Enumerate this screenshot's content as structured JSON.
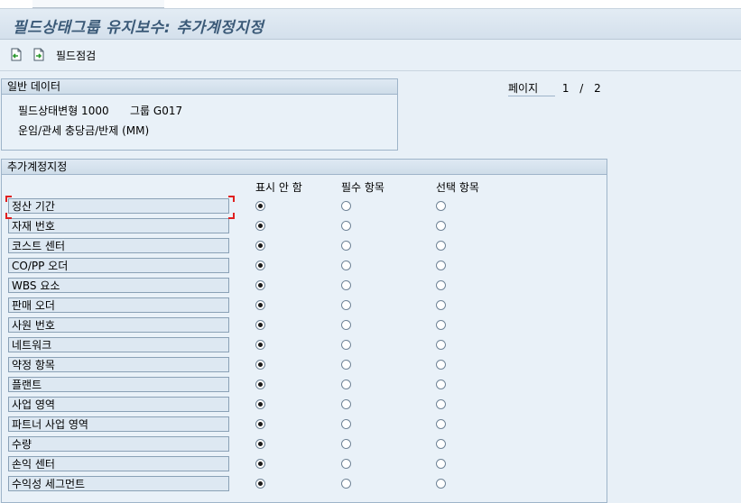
{
  "window": {
    "title": "필드상태그룹 유지보수: 추가계정지정"
  },
  "toolbar": {
    "icons": [
      "prev-screen-icon",
      "next-screen-icon"
    ],
    "check_label": "필드점검"
  },
  "general_data": {
    "title": "일반 데이터",
    "line1": "필드상태변형 1000",
    "line1b": "그룹 G017",
    "line2": "운임/관세 충당금/반제 (MM)"
  },
  "page": {
    "label": "페이지",
    "current": "1",
    "sep": "/",
    "total": "2"
  },
  "additional": {
    "title": "추가계정지정",
    "col_suppress": "표시 안 함",
    "col_required": "필수 항목",
    "col_optional": "선택 항목",
    "rows": [
      {
        "label": "정산 기간",
        "selected": "suppress"
      },
      {
        "label": "자재 번호",
        "selected": "suppress"
      },
      {
        "label": "코스트 센터",
        "selected": "suppress"
      },
      {
        "label": "CO/PP 오더",
        "selected": "suppress"
      },
      {
        "label": "WBS 요소",
        "selected": "suppress"
      },
      {
        "label": "판매 오더",
        "selected": "suppress"
      },
      {
        "label": "사원 번호",
        "selected": "suppress"
      },
      {
        "label": "네트워크",
        "selected": "suppress"
      },
      {
        "label": "약정 항목",
        "selected": "suppress"
      },
      {
        "label": "플랜트",
        "selected": "suppress"
      },
      {
        "label": "사업 영역",
        "selected": "suppress"
      },
      {
        "label": "파트너 사업 영역",
        "selected": "suppress"
      },
      {
        "label": "수량",
        "selected": "suppress"
      },
      {
        "label": "손익 센터",
        "selected": "suppress"
      },
      {
        "label": "수익성 세그먼트",
        "selected": "suppress"
      }
    ]
  },
  "colors": {
    "title_text": "#3b5a78",
    "focus_corner": "#e02020",
    "background": "#e8f0f7"
  }
}
